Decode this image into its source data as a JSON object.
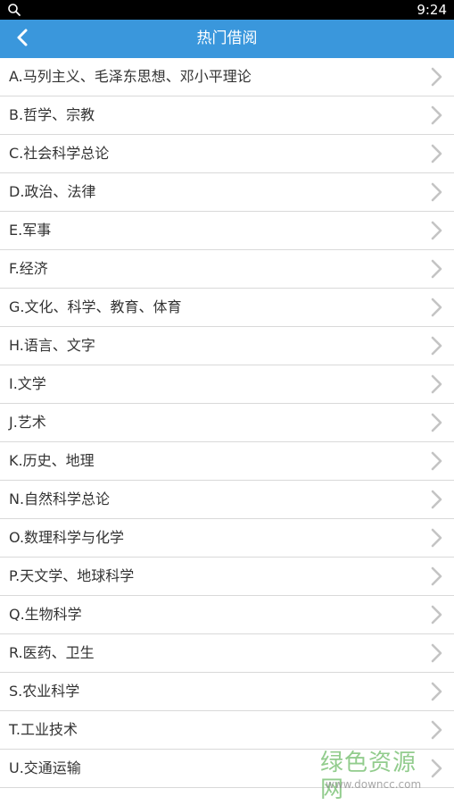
{
  "status_bar": {
    "time": "9:24",
    "left_icon": "search-icon"
  },
  "app_bar": {
    "back_icon": "chevron-left-icon",
    "title": "热门借阅",
    "background_color": "#3a97dc"
  },
  "categories": [
    {
      "label": "A.马列主义、毛泽东思想、邓小平理论"
    },
    {
      "label": "B.哲学、宗教"
    },
    {
      "label": "C.社会科学总论"
    },
    {
      "label": "D.政治、法律"
    },
    {
      "label": "E.军事"
    },
    {
      "label": "F.经济"
    },
    {
      "label": "G.文化、科学、教育、体育"
    },
    {
      "label": "H.语言、文字"
    },
    {
      "label": "I.文学"
    },
    {
      "label": "J.艺术"
    },
    {
      "label": "K.历史、地理"
    },
    {
      "label": "N.自然科学总论"
    },
    {
      "label": "O.数理科学与化学"
    },
    {
      "label": "P.天文学、地球科学"
    },
    {
      "label": "Q.生物科学"
    },
    {
      "label": "R.医药、卫生"
    },
    {
      "label": "S.农业科学"
    },
    {
      "label": "T.工业技术"
    },
    {
      "label": "U.交通运输"
    }
  ],
  "watermark": {
    "name": "绿色资源网",
    "url": "www.downcc.com"
  }
}
